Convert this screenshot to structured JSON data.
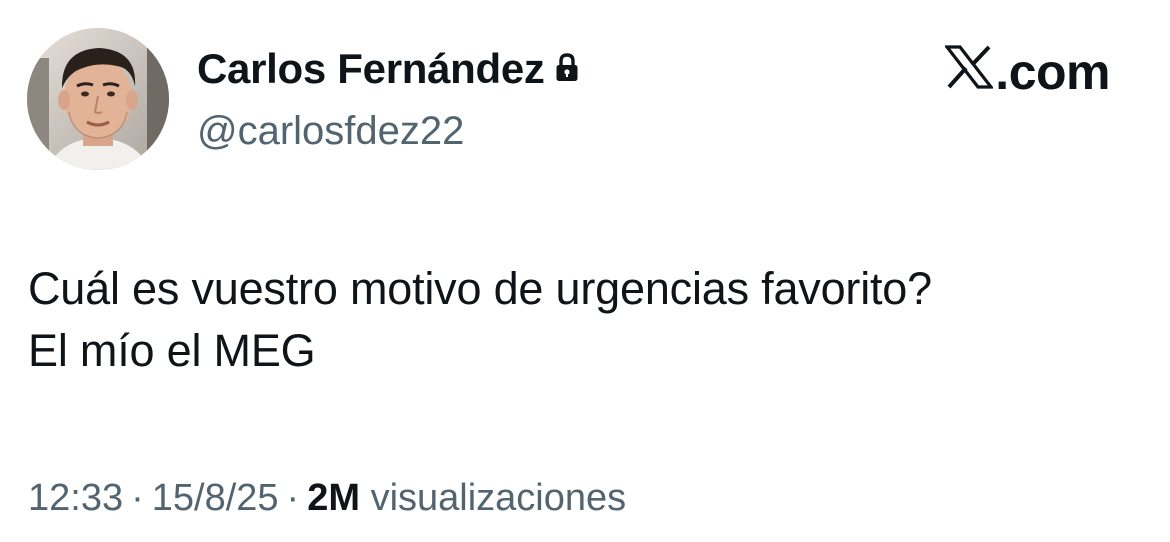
{
  "author": {
    "name": "Carlos Fernández",
    "handle": "@carlosfdez22",
    "protected_icon": "lock-icon",
    "avatar_icon": "avatar"
  },
  "brand": {
    "logo_icon": "x-logo-icon",
    "domain": ".com"
  },
  "tweet": {
    "lines": [
      "Cuál es vuestro motivo de urgencias favorito?",
      "El mío el MEG"
    ]
  },
  "meta": {
    "time": "12:33",
    "separator": "·",
    "date": "15/8/25",
    "views_count": "2M",
    "views_label": "visualizaciones"
  },
  "colors": {
    "text": "#0f1419",
    "secondary": "#536471",
    "background": "#ffffff"
  }
}
